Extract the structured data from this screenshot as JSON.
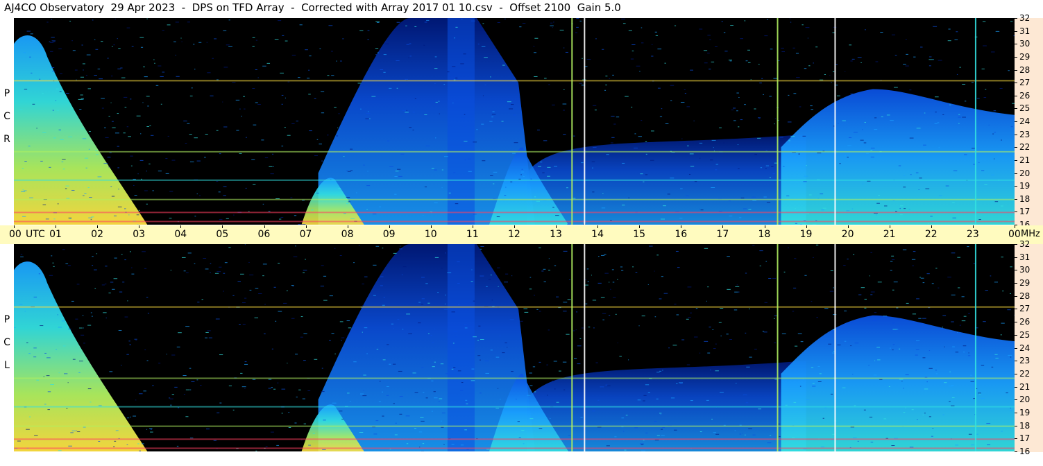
{
  "title": "AJ4CO Observatory  29 Apr 2023  -  DPS on TFD Array  -  Corrected with Array 2017 01 10.csv  -  Offset 2100  Gain 5.0",
  "panels": [
    {
      "polarization": [
        "R",
        "C",
        "P"
      ]
    },
    {
      "polarization": [
        "L",
        "C",
        "P"
      ]
    }
  ],
  "time_axis": {
    "labels": [
      "00",
      "01",
      "02",
      "03",
      "04",
      "05",
      "06",
      "07",
      "08",
      "09",
      "10",
      "11",
      "12",
      "13",
      "14",
      "15",
      "16",
      "17",
      "18",
      "19",
      "20",
      "21",
      "22",
      "23",
      "00"
    ],
    "utc_label": "UTC",
    "freq_unit": "MHz"
  },
  "freq_axis": {
    "labels": [
      "32",
      "31",
      "30",
      "29",
      "28",
      "27",
      "26",
      "25",
      "24",
      "23",
      "22",
      "21",
      "20",
      "19",
      "18",
      "17",
      "16"
    ]
  },
  "chart_data": {
    "type": "heatmap",
    "title": "AJ4CO Observatory  29 Apr 2023  -  DPS on TFD Array  -  Corrected with Array 2017 01 10.csv  -  Offset 2100  Gain 5.0",
    "x": {
      "label": "UTC",
      "range": [
        0,
        24
      ],
      "unit": "hours"
    },
    "y": {
      "label": "MHz",
      "range": [
        16,
        32
      ],
      "unit": "MHz"
    },
    "colormap": [
      "#000000",
      "#001a80",
      "#0a4fe0",
      "#1aa0ff",
      "#33e0e0",
      "#b0f060",
      "#ffe040",
      "#ff4060"
    ],
    "series": [
      {
        "name": "RCP"
      },
      {
        "name": "LCP"
      }
    ],
    "intensity_regions": [
      {
        "hours": [
          0,
          3.2
        ],
        "level": "high",
        "shape": "decaying broadband, strongest below 22 MHz"
      },
      {
        "hours": [
          7.0,
          8.3
        ],
        "level": "medium",
        "shape": "hump below 19 MHz"
      },
      {
        "hours": [
          7.3,
          12.5
        ],
        "level": "low-medium",
        "shape": "diffuse blue background"
      },
      {
        "hours": [
          11.4,
          13.3
        ],
        "level": "medium",
        "shape": "rising feature below 22 MHz"
      },
      {
        "hours": [
          13.3,
          19.0
        ],
        "level": "low-medium",
        "shape": "mottled blue below 23 MHz"
      },
      {
        "hours": [
          18.5,
          24
        ],
        "level": "medium-high",
        "shape": "broadband arc up to 26 MHz"
      }
    ],
    "vertical_lines_hours": [
      13.37,
      13.67,
      18.3,
      19.68,
      23.05
    ],
    "horizontal_bands_mhz": [
      27.2,
      17.0,
      18.0,
      19.5,
      21.7,
      16.3
    ]
  }
}
